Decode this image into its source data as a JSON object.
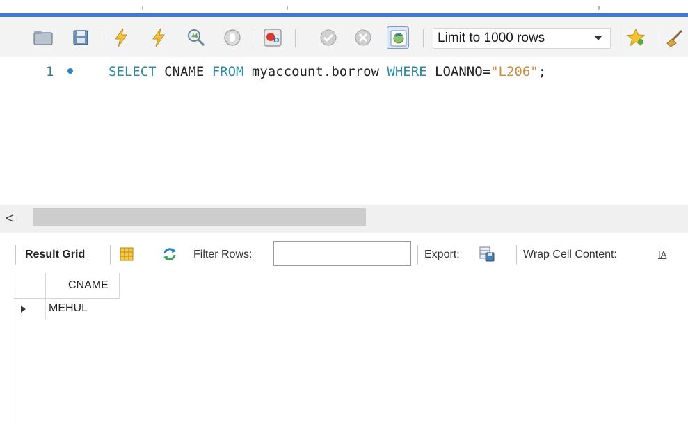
{
  "toolbar": {
    "icons": [
      "open-folder-icon",
      "save-icon",
      "execute-lightning-icon",
      "execute-current-lightning-icon",
      "explain-magnifier-icon",
      "stop-icon",
      "toggle-error-icon",
      "commit-icon",
      "rollback-icon",
      "autocommit-toggle-icon",
      "bookmark-star-icon",
      "beautify-broom-icon"
    ],
    "limit_label": "Limit to 1000 rows"
  },
  "editor": {
    "line_number": "1",
    "code": {
      "kw_select": "SELECT",
      "col": " CNAME ",
      "kw_from": "FROM",
      "table": " myaccount.borrow ",
      "kw_where": "WHERE",
      "cond": " LOANNO=",
      "literal": "\"L206\"",
      "end": ";"
    }
  },
  "scrollbar": {
    "left_arrow": "<"
  },
  "result_toolbar": {
    "result_grid_label": "Result Grid",
    "filter_label": "Filter Rows:",
    "filter_value": "",
    "export_label": "Export:",
    "wrap_label": "Wrap Cell Content:",
    "wrap_icon_glyph": "IA"
  },
  "grid": {
    "columns": [
      "CNAME"
    ],
    "rows": [
      [
        "MEHUL"
      ]
    ]
  },
  "colors": {
    "keyword": "#2e8ba6",
    "string": "#d08c3c",
    "accent": "#3c78d8"
  }
}
